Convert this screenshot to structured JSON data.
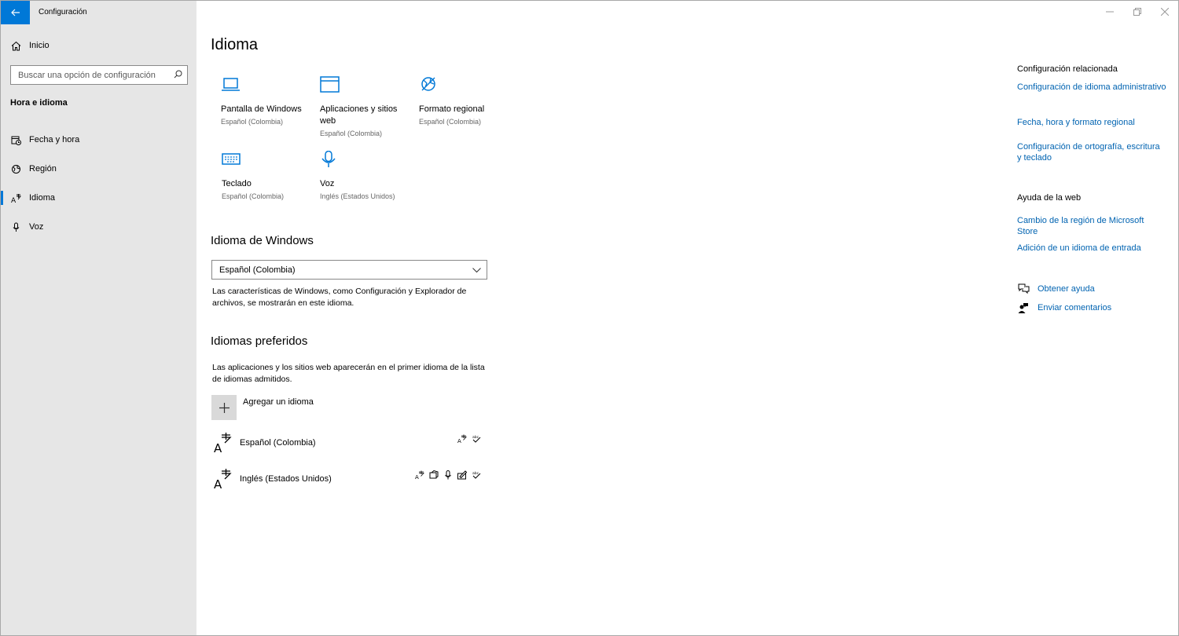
{
  "window": {
    "title": "Configuración",
    "controls": {
      "minimize": "minimize-icon",
      "restore": "restore-icon",
      "close": "close-icon"
    }
  },
  "sidebar": {
    "home_label": "Inicio",
    "search_placeholder": "Buscar una opción de configuración",
    "section_title": "Hora e idioma",
    "items": [
      {
        "label": "Fecha y hora",
        "icon": "calendar-clock-icon"
      },
      {
        "label": "Región",
        "icon": "globe-icon"
      },
      {
        "label": "Idioma",
        "icon": "language-icon",
        "active": true
      },
      {
        "label": "Voz",
        "icon": "microphone-icon"
      }
    ]
  },
  "main": {
    "title": "Idioma",
    "tiles": [
      {
        "name": "Pantalla de Windows",
        "sub": "Español (Colombia)",
        "icon": "laptop-icon"
      },
      {
        "name": "Aplicaciones y sitios web",
        "sub": "Español (Colombia)",
        "icon": "browser-window-icon"
      },
      {
        "name": "Formato regional",
        "sub": "Español (Colombia)",
        "icon": "globe-format-icon"
      },
      {
        "name": "Teclado",
        "sub": "Español (Colombia)",
        "icon": "keyboard-icon"
      },
      {
        "name": "Voz",
        "sub": "Inglés (Estados Unidos)",
        "icon": "microphone-icon"
      }
    ],
    "windows_language": {
      "heading": "Idioma de Windows",
      "selected": "Español (Colombia)",
      "description": "Las características de Windows, como Configuración y Explorador de archivos, se mostrarán en este idioma."
    },
    "preferred": {
      "heading": "Idiomas preferidos",
      "description": "Las aplicaciones y los sitios web aparecerán en el primer idioma de la lista de idiomas admitidos.",
      "add_label": "Agregar un idioma",
      "languages": [
        {
          "name": "Español (Colombia)",
          "features": [
            "display-language-icon",
            "spellcheck-icon"
          ]
        },
        {
          "name": "Inglés (Estados Unidos)",
          "features": [
            "display-language-icon",
            "text-to-speech-icon",
            "speech-recognition-icon",
            "handwriting-icon",
            "spellcheck-icon"
          ]
        }
      ]
    }
  },
  "related": {
    "title": "Configuración relacionada",
    "links": [
      "Configuración de idioma administrativo",
      "Fecha, hora y formato regional",
      "Configuración de ortografía, escritura y teclado"
    ],
    "web_help_title": "Ayuda de la web",
    "web_links": [
      "Cambio de la región de Microsoft Store",
      "Adición de un idioma de entrada"
    ],
    "get_help": "Obtener ayuda",
    "feedback": "Enviar comentarios"
  },
  "colors": {
    "accent": "#0078d7",
    "link": "#0063b1",
    "sidebar_bg": "#e6e6e6"
  }
}
